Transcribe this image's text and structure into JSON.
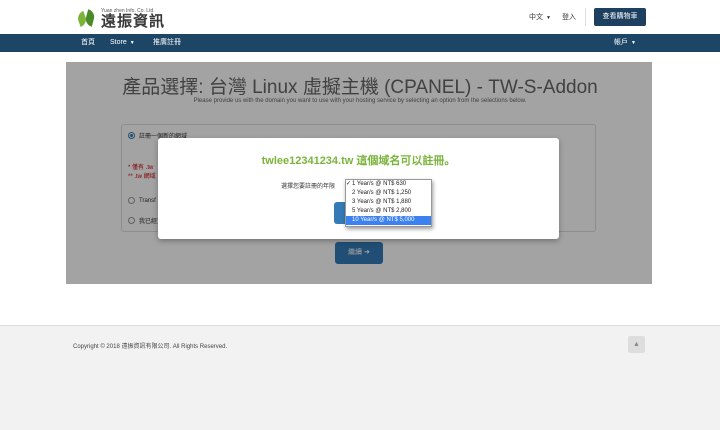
{
  "header": {
    "logo_en": "Yuan zhen Info. Co. Ltd.",
    "logo_zh": "遠振資訊",
    "language": "中文",
    "login": "登入",
    "cart_button": "查看購物車"
  },
  "nav": {
    "items": [
      "首頁",
      "Store",
      "推廣註冊"
    ],
    "account": "帳戶"
  },
  "page": {
    "title": "產品選擇: 台灣 Linux 虛擬主機 (CPANEL) - TW-S-Addon",
    "subtitle": "Please provide us with the domain you want to use with your hosting service by selecting an option from the selections below.",
    "options": [
      "註冊一個新的網域",
      "Transf",
      "我已經買"
    ],
    "notes": [
      "* 僅有 .tw",
      "** .tw 網域"
    ],
    "continue_button": "繼續"
  },
  "modal": {
    "message": "twlee12341234.tw 這個域名可以註冊。",
    "label": "選擇您要註冊的年限",
    "check": "✓",
    "options": [
      "1 Year/s @ NT$ 630",
      "2 Year/s @ NT$ 1,250",
      "3 Year/s @ NT$ 1,880",
      "5 Year/s @ NT$ 2,800",
      "10 Year/s @ NT$ 5,000"
    ]
  },
  "footer": {
    "copyright": "Copyright © 2018 遠振資訊有限公司. All Rights Reserved.",
    "top_glyph": "▲"
  },
  "colors": {
    "nav": "#1d4565",
    "cart_button": "#1d3f60",
    "available_text": "#7ab43a",
    "primary_button": "#337ab7",
    "dropdown_selected": "#3b82f0"
  }
}
